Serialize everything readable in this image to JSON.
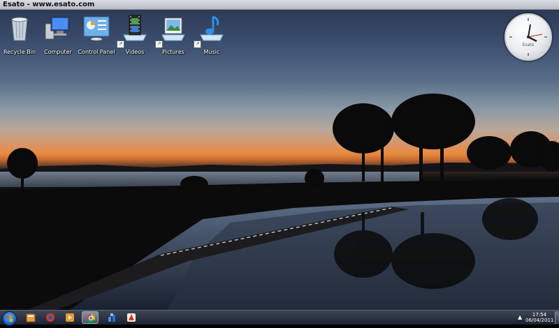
{
  "window": {
    "title": "Esato - www.esato.com"
  },
  "desktop": {
    "icons": [
      {
        "label": "Recycle Bin",
        "icon": "recycle-bin-icon",
        "shortcut": false
      },
      {
        "label": "Computer",
        "icon": "computer-icon",
        "shortcut": false
      },
      {
        "label": "Control Panel",
        "icon": "control-panel-icon",
        "shortcut": false
      },
      {
        "label": "Videos",
        "icon": "videos-icon",
        "shortcut": true
      },
      {
        "label": "Pictures",
        "icon": "pictures-icon",
        "shortcut": true
      },
      {
        "label": "Music",
        "icon": "music-icon",
        "shortcut": true
      }
    ],
    "wallpaper": "sunset-lake-with-trees",
    "gadget": {
      "type": "clock",
      "brand": "Esato"
    }
  },
  "taskbar": {
    "items": [
      {
        "icon": "start-orb-icon"
      },
      {
        "icon": "library-folder-icon"
      },
      {
        "icon": "browser-red-icon"
      },
      {
        "icon": "media-player-icon"
      },
      {
        "icon": "chrome-icon",
        "active": true
      },
      {
        "icon": "network-app-icon"
      },
      {
        "icon": "red-app-icon"
      }
    ],
    "tray": {
      "arrow": "▲",
      "time": "17:54",
      "date": "06/04/2011"
    }
  },
  "colors": {
    "sky_top": "#2c3a55",
    "sunset": "#e88a3e",
    "taskbar": "#1c2230",
    "accent": "#2a6ad0"
  }
}
